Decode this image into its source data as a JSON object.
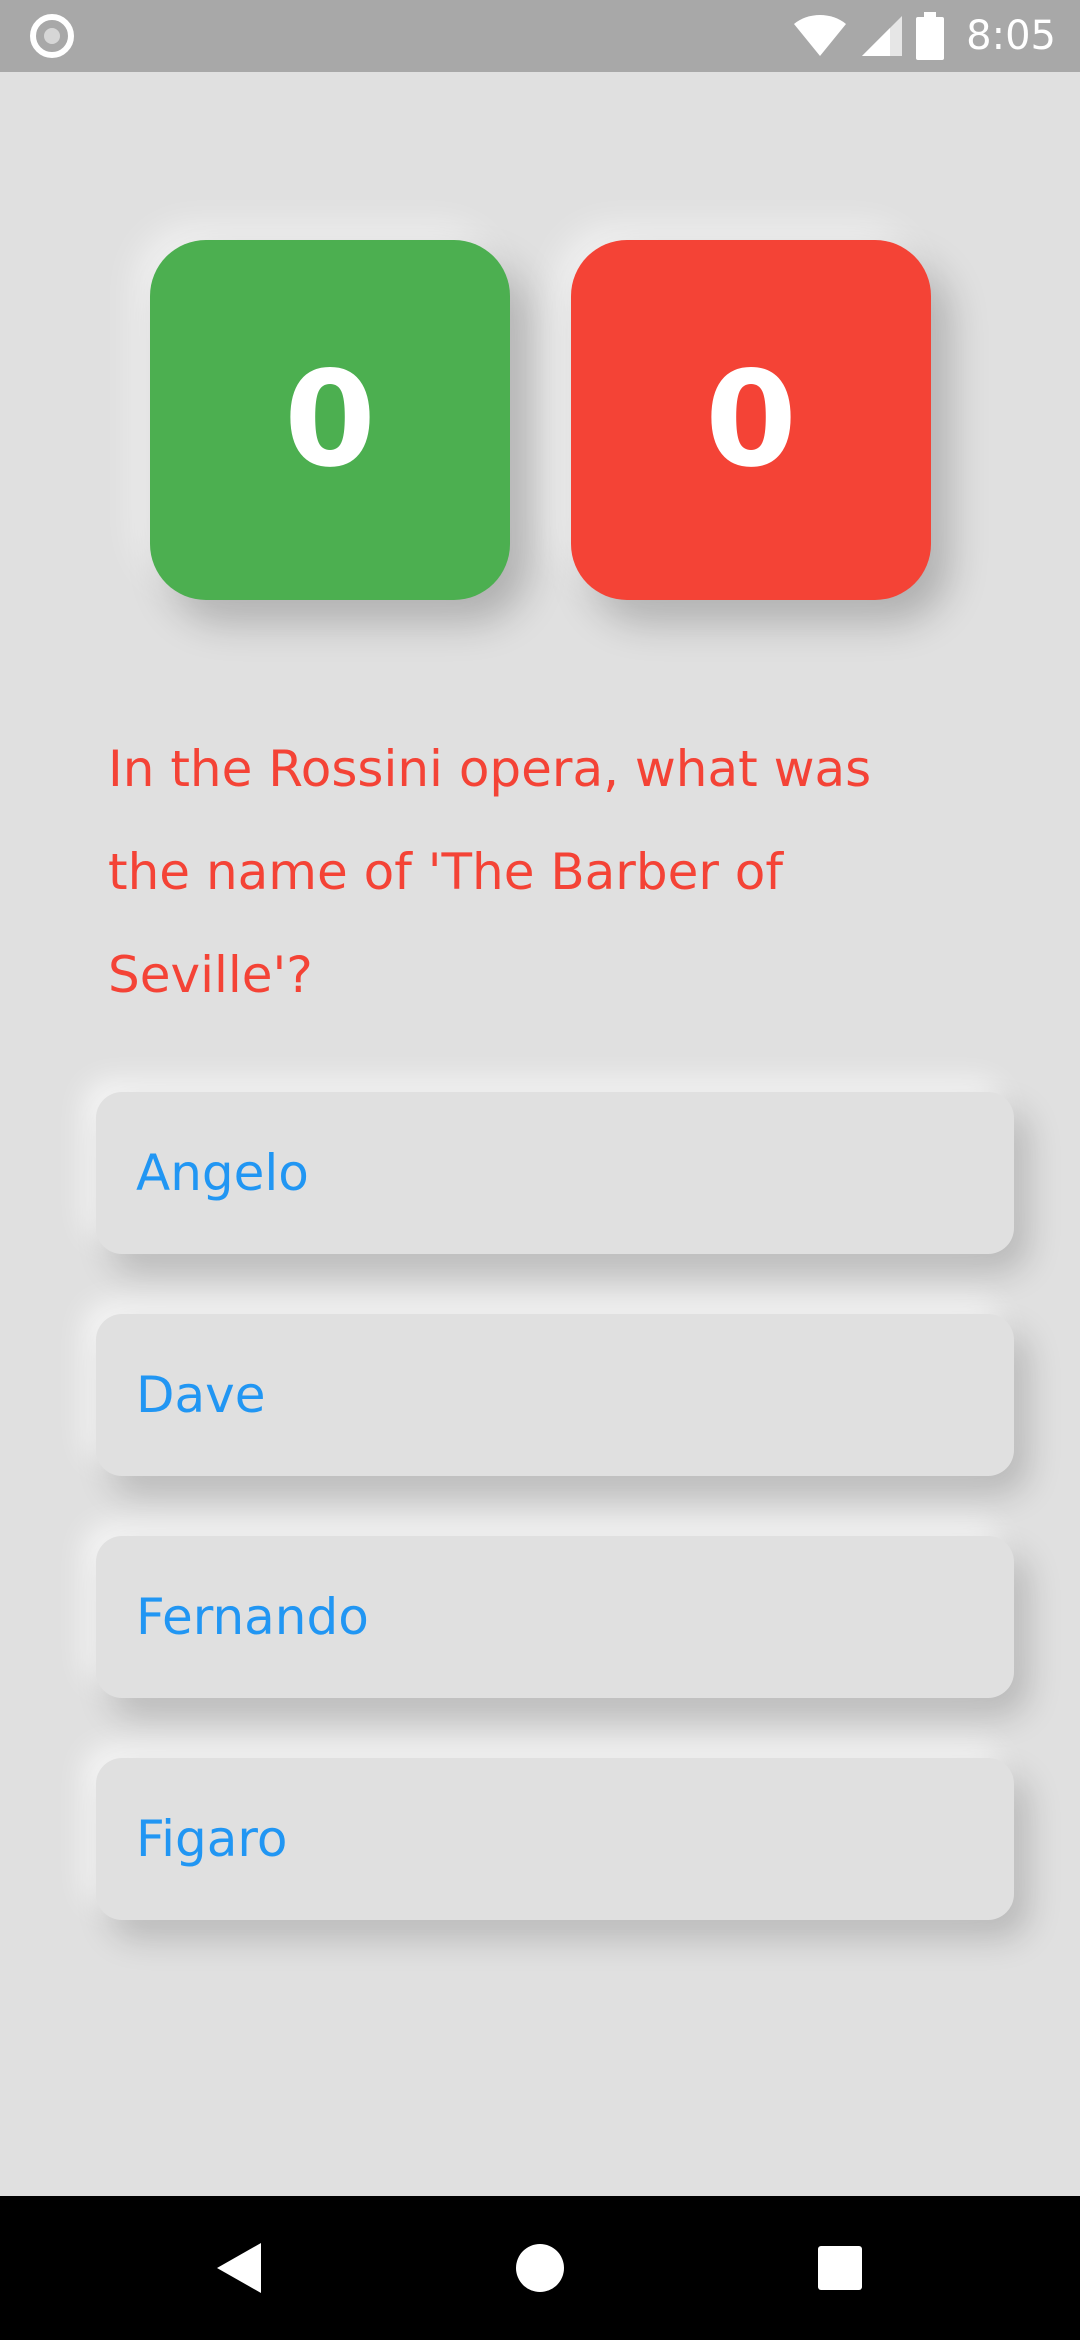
{
  "status_bar": {
    "time": "8:05",
    "icons": [
      "notification-icon",
      "wifi-icon",
      "signal-icon",
      "battery-icon"
    ]
  },
  "scores": {
    "correct": "0",
    "wrong": "0",
    "correct_color": "#4caf50",
    "wrong_color": "#f44336"
  },
  "question": {
    "text": "In the Rossini opera, what was the name of 'The Barber of Seville'?",
    "color": "#f44336"
  },
  "answers": [
    {
      "label": "Angelo"
    },
    {
      "label": "Dave"
    },
    {
      "label": "Fernando"
    },
    {
      "label": "Figaro"
    }
  ],
  "answer_color": "#2196f3",
  "background_color": "#e0e0e0",
  "nav_bar": {
    "icons": [
      "back-icon",
      "home-icon",
      "recent-apps-icon"
    ]
  }
}
